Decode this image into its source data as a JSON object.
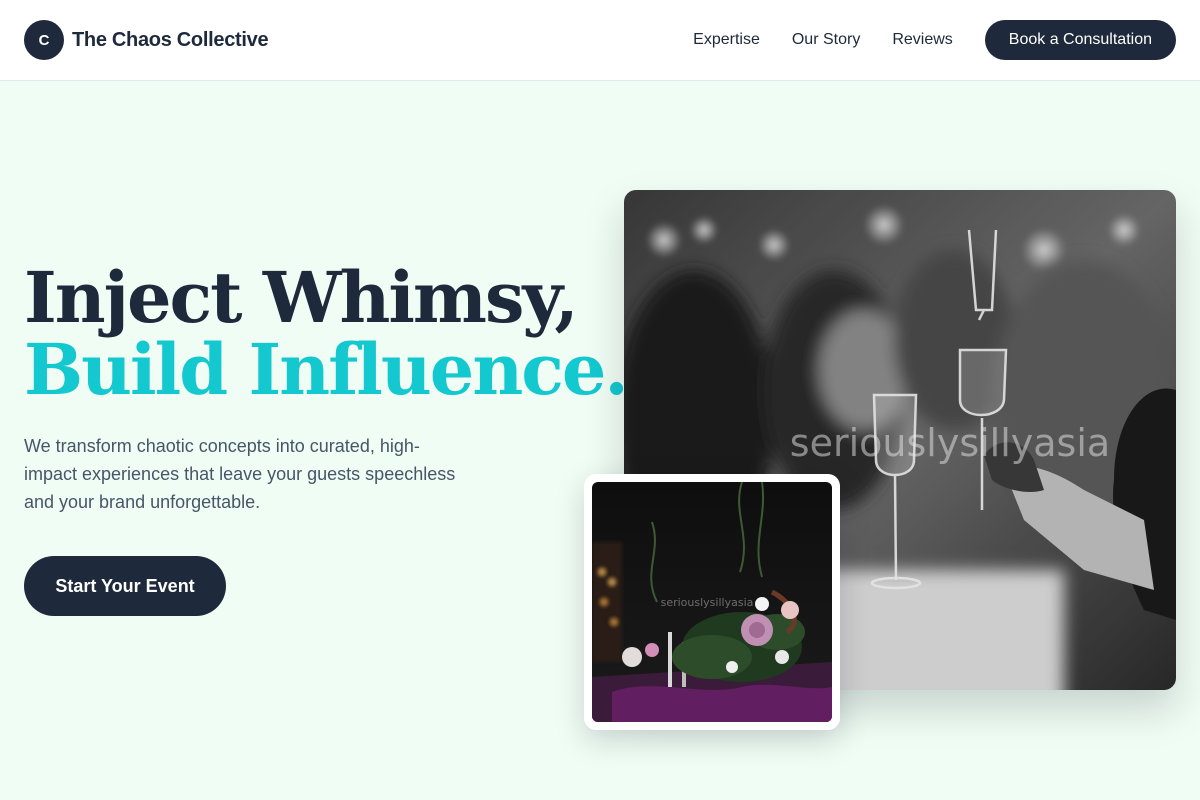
{
  "nav": {
    "logo_letter": "C",
    "brand_name": "The Chaos Collective",
    "links": [
      "Expertise",
      "Our Story",
      "Reviews"
    ],
    "cta_label": "Book a Consultation"
  },
  "hero": {
    "title_line1": "Inject Whimsy,",
    "title_line2": "Build Influence.",
    "subtitle": "We transform chaotic concepts into curated, high-impact experiences that leave your guests speechless and your brand unforgettable.",
    "button_label": "Start Your Event",
    "accent_color": "#14c8d0",
    "dark_color": "#1e293b",
    "background_color": "#f0fdf4"
  },
  "images": {
    "main_watermark": "seriouslysillyasia",
    "small_watermark": "seriouslysillyasia"
  }
}
